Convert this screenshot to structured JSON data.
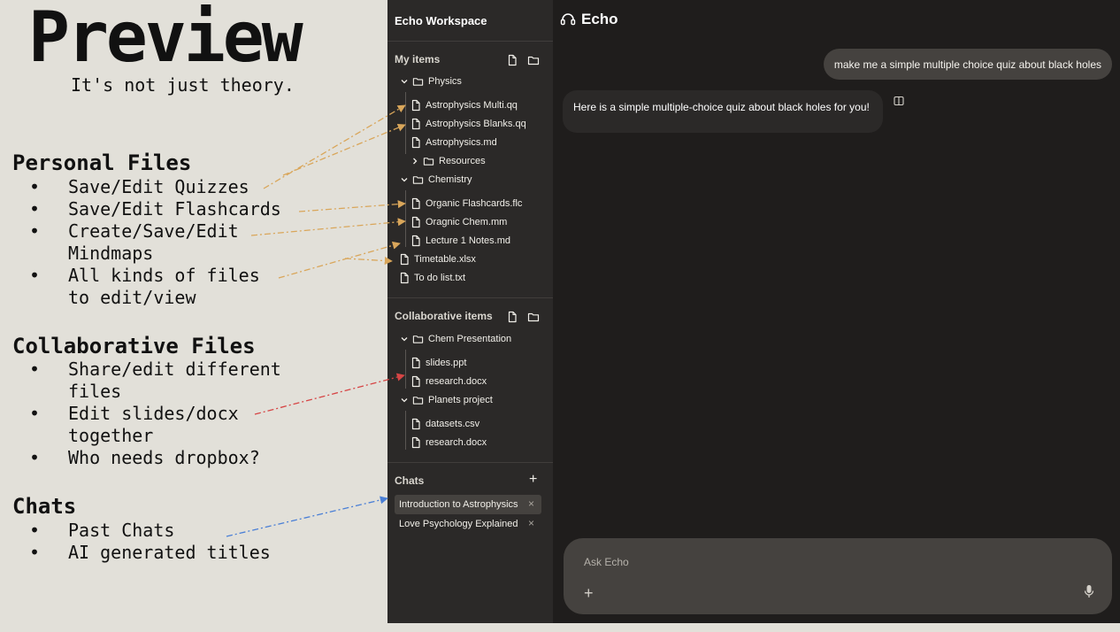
{
  "slide": {
    "title": "Preview",
    "subtitle": "It's not just theory.",
    "sections": [
      {
        "heading": "Personal Files",
        "bullets": [
          "Save/Edit Quizzes",
          "Save/Edit Flashcards",
          "Create/Save/Edit Mindmaps",
          "All kinds of files to edit/view"
        ]
      },
      {
        "heading": "Collaborative Files",
        "bullets": [
          "Share/edit different files",
          "Edit slides/docx together",
          "Who needs dropbox?"
        ]
      },
      {
        "heading": "Chats",
        "bullets": [
          "Past Chats",
          "AI generated titles"
        ]
      }
    ]
  },
  "sidebar": {
    "workspace_title": "Echo Workspace",
    "my_items": {
      "label": "My items",
      "physics_folder": "Physics",
      "physics_files": [
        "Astrophysics Multi.qq",
        "Astrophysics Blanks.qq",
        "Astrophysics.md"
      ],
      "resources_folder": "Resources",
      "chemistry_folder": "Chemistry",
      "chemistry_files": [
        "Organic Flashcards.flc",
        "Oragnic Chem.mm",
        "Lecture 1 Notes.md"
      ],
      "root_files": [
        "Timetable.xlsx",
        "To do list.txt"
      ]
    },
    "collab_items": {
      "label": "Collaborative items",
      "chem_folder": "Chem Presentation",
      "chem_files": [
        "slides.ppt",
        "research.docx"
      ],
      "planets_folder": "Planets project",
      "planets_files": [
        "datasets.csv",
        "research.docx"
      ]
    },
    "chats": {
      "label": "Chats",
      "items": [
        "Introduction to Astrophysics",
        "Love Psychology Explained"
      ],
      "add_symbol": "+",
      "close_symbol": "×"
    }
  },
  "main": {
    "app_name": "Echo",
    "user_message": "make me a simple multiple choice quiz about black holes",
    "assistant_message": "Here is a simple multiple-choice quiz about black holes for you!",
    "composer_placeholder": "Ask Echo",
    "composer_plus": "+"
  },
  "colors": {
    "slide_bg": "#e2e0d9",
    "sidebar_bg": "#2b2928",
    "main_bg": "#1f1d1c",
    "bubble_bg": "#45423f",
    "arrow_orange": "#d9a65a",
    "arrow_red": "#d64545",
    "arrow_blue": "#4a7fd6"
  },
  "icons": [
    "file-icon",
    "folder-icon",
    "chevron-down-icon",
    "chevron-right-icon",
    "new-file-icon",
    "new-folder-icon",
    "plus-icon",
    "close-icon",
    "headset-icon",
    "panel-toggle-icon",
    "microphone-icon"
  ]
}
